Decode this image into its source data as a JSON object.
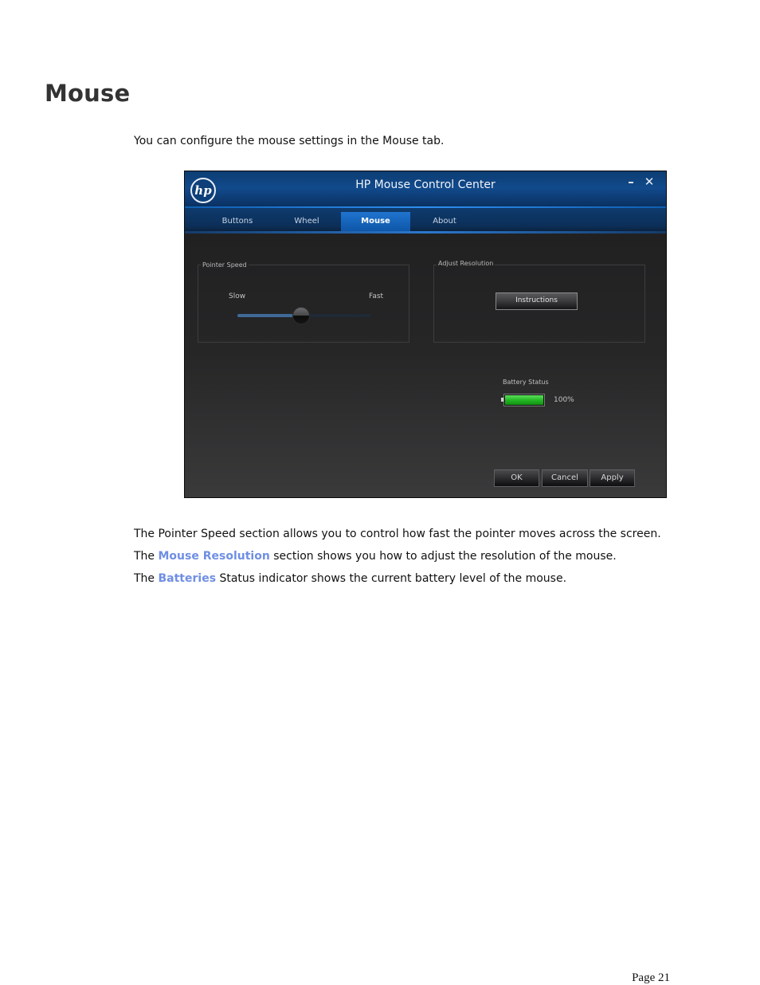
{
  "heading": "Mouse",
  "intro": "You can configure the mouse settings in the Mouse tab.",
  "window": {
    "title": "HP Mouse Control Center",
    "logo_text": "hp",
    "minimize_glyph": "–",
    "close_glyph": "✕",
    "tabs": [
      {
        "label": "Buttons",
        "active": false
      },
      {
        "label": "Wheel",
        "active": false
      },
      {
        "label": "Mouse",
        "active": true
      },
      {
        "label": "About",
        "active": false
      }
    ],
    "pointer_speed": {
      "label": "Pointer Speed",
      "slow": "Slow",
      "fast": "Fast",
      "value": 0.47
    },
    "adjust_resolution": {
      "label": "Adjust Resolution",
      "button": "Instructions"
    },
    "battery": {
      "label": "Battery Status",
      "value_text": "100%",
      "level": 1.0,
      "color": "#2bbf2b"
    },
    "buttons": {
      "ok": "OK",
      "cancel": "Cancel",
      "apply": "Apply"
    }
  },
  "body": {
    "line1": "The Pointer Speed section allows you to control how fast the pointer moves across the screen.",
    "line2_prefix": "The ",
    "line2_highlight": "Mouse Resolution",
    "line2_suffix": " section shows you how to adjust the resolution of the mouse.",
    "line3_prefix": "The ",
    "line3_highlight": "Batteries",
    "line3_suffix": " Status indicator shows the current battery level of the mouse."
  },
  "page_number": "Page 21",
  "colors": {
    "highlight": "#6f8fe4",
    "accent_blue": "#1f74cf"
  }
}
